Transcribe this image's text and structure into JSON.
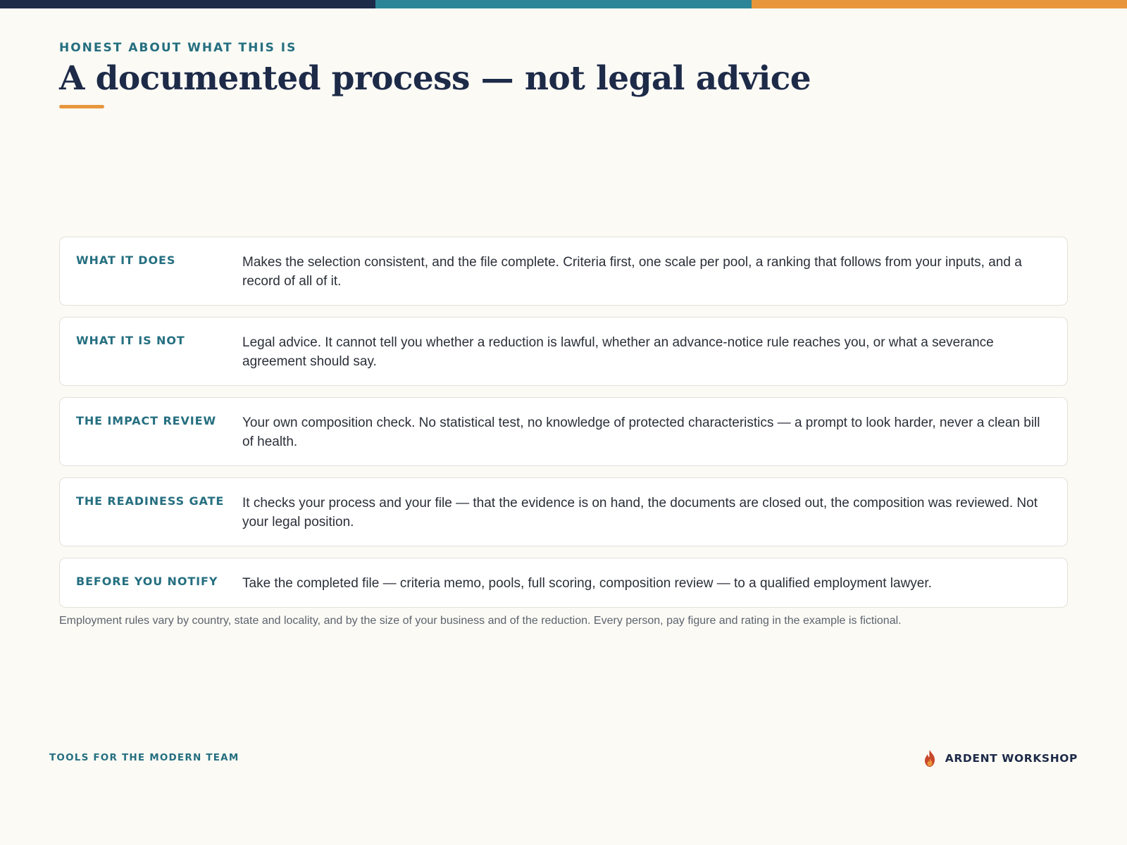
{
  "colors": {
    "navy": "#1d2a48",
    "teal": "#2b8596",
    "orange": "#e8963c",
    "background": "#fbfaf5",
    "label_teal": "#256f80",
    "logo_flame": "#c8462a"
  },
  "header": {
    "eyebrow": "HONEST ABOUT WHAT THIS IS",
    "title": "A documented process — not legal advice"
  },
  "rows": [
    {
      "label": "WHAT IT DOES",
      "text": "Makes the selection consistent, and the file complete. Criteria first, one scale per pool, a ranking that follows from your inputs, and a record of all of it."
    },
    {
      "label": "WHAT IT IS NOT",
      "text": "Legal advice. It cannot tell you whether a reduction is lawful, whether an advance-notice rule reaches you, or what a severance agreement should say."
    },
    {
      "label": "THE IMPACT REVIEW",
      "text": "Your own composition check. No statistical test, no knowledge of protected characteristics — a prompt to look harder, never a clean bill of health."
    },
    {
      "label": "THE READINESS GATE",
      "text": "It checks your process and your file — that the evidence is on hand, the documents are closed out, the composition was reviewed. Not your legal position."
    },
    {
      "label": "BEFORE YOU NOTIFY",
      "text": "Take the completed file — criteria memo, pools, full scoring, composition review — to a qualified employment lawyer."
    }
  ],
  "footnote": "Employment rules vary by country, state and locality, and by the size of your business and of the reduction. Every person, pay figure and rating in the example is fictional.",
  "footer": {
    "tagline": "TOOLS FOR THE MODERN TEAM",
    "brand_icon": "flame-icon",
    "brand_name": "ARDENT WORKSHOP"
  }
}
